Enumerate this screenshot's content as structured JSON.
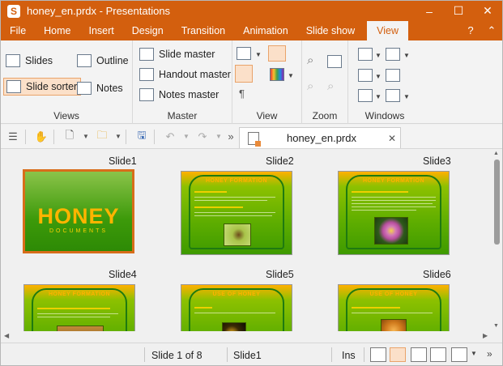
{
  "window": {
    "app_icon": "S",
    "title": "honey_en.prdx - Presentations",
    "minimize": "–",
    "maximize": "☐",
    "close": "✕"
  },
  "menu": {
    "tabs": [
      "File",
      "Home",
      "Insert",
      "Design",
      "Transition",
      "Animation",
      "Slide show",
      "View"
    ],
    "active": "View",
    "help": "?",
    "collapse": "⌃"
  },
  "ribbon": {
    "views": {
      "label": "Views",
      "slides": "Slides",
      "outline": "Outline",
      "slide_sorter": "Slide sorter",
      "notes": "Notes"
    },
    "master": {
      "label": "Master",
      "slide_master": "Slide master",
      "handout_master": "Handout master",
      "notes_master": "Notes master"
    },
    "view_group": {
      "label": "View"
    },
    "zoom": {
      "label": "Zoom"
    },
    "windows": {
      "label": "Windows"
    }
  },
  "toolbar": {
    "document_tab": "honey_en.prdx",
    "close_tab": "✕",
    "more": "»"
  },
  "slides": [
    {
      "label": "Slide1",
      "title": "HONEY",
      "subtitle": "DOCUMENTS"
    },
    {
      "label": "Slide2",
      "title": "HONEY FORMATION"
    },
    {
      "label": "Slide3",
      "title": "HONEY FORMATION"
    },
    {
      "label": "Slide4",
      "title": "HONEY FORMATION"
    },
    {
      "label": "Slide5",
      "title": "USE OF HONEY"
    },
    {
      "label": "Slide6",
      "title": "USE OF HONEY"
    }
  ],
  "status": {
    "position": "Slide 1 of 8",
    "slide_name": "Slide1",
    "mode": "Ins"
  },
  "colors": {
    "accent": "#d35f0e",
    "selection": "#d86d1a",
    "slide_green": "#5fae00",
    "slide_title": "#ffb100"
  }
}
